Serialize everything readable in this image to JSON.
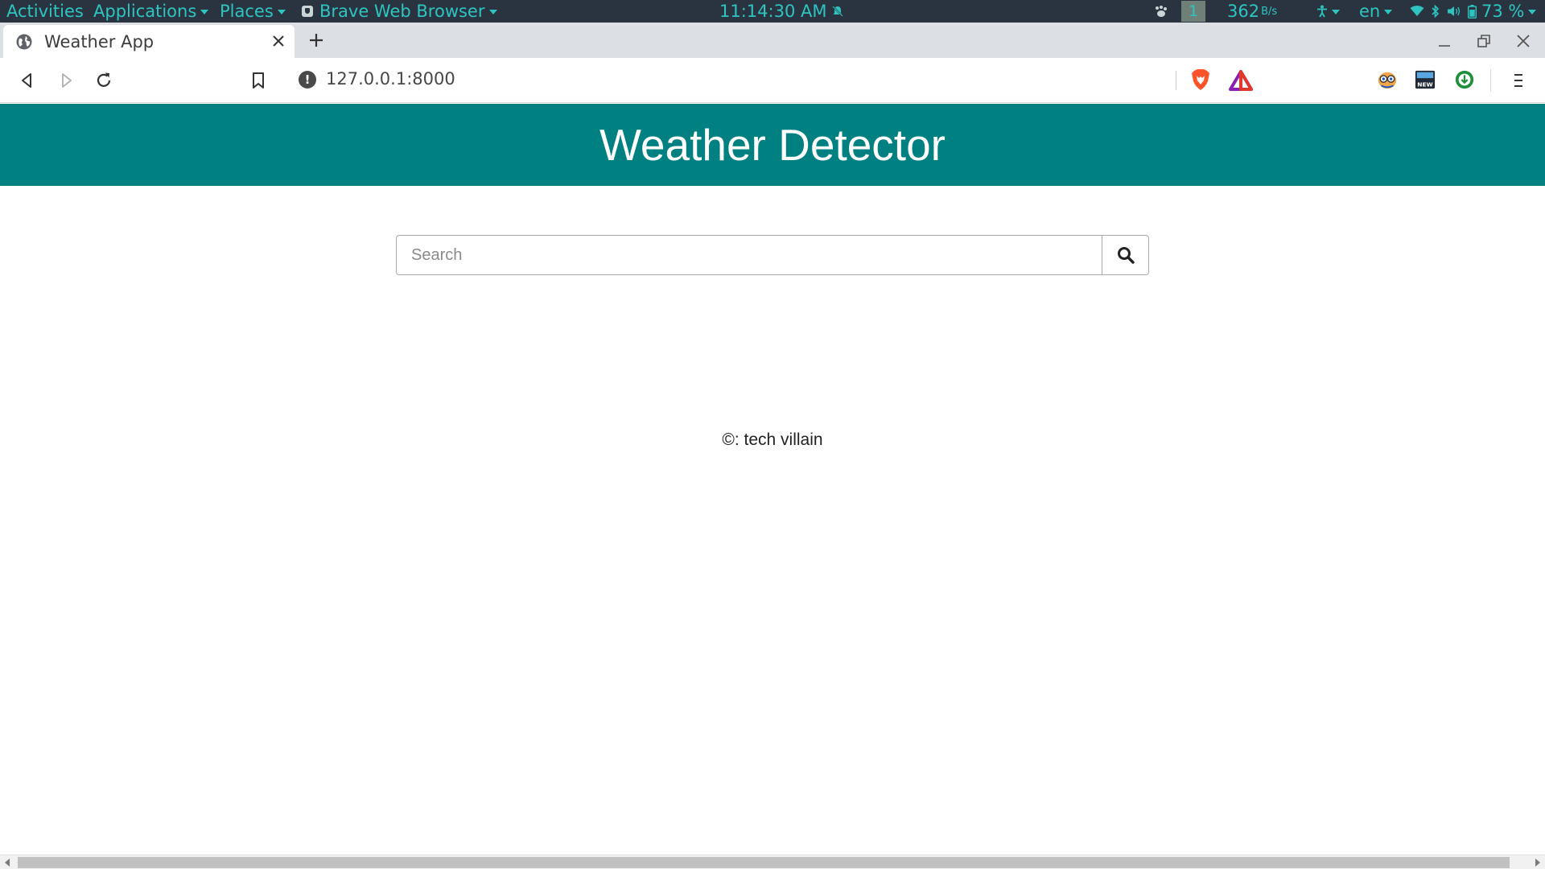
{
  "topbar": {
    "activities": "Activities",
    "applications": "Applications",
    "places": "Places",
    "app_menu": "Brave Web Browser",
    "clock": "11:14:30 AM",
    "workspace": "1",
    "net_speed": "362",
    "net_unit": "B/s",
    "keyboard_layout": "en",
    "battery": "73 %"
  },
  "browser": {
    "tab_title": "Weather App",
    "url": "127.0.0.1:8000"
  },
  "page": {
    "header_title": "Weather Detector",
    "header_color": "#008080",
    "search_placeholder": "Search",
    "search_value": "",
    "footer_text": "©: tech villain"
  }
}
